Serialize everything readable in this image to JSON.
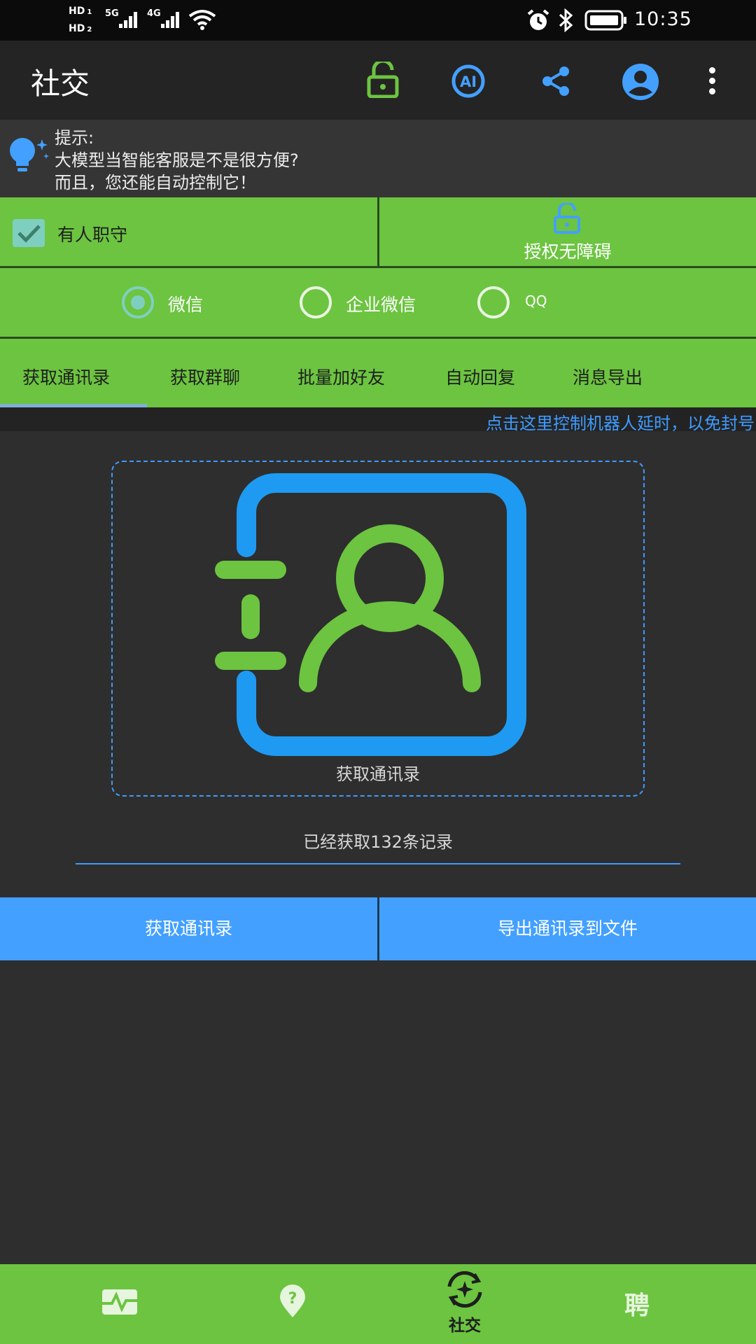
{
  "status_bar": {
    "hd1": "HD",
    "hd1_sub": "1",
    "hd2": "HD",
    "hd2_sub": "2",
    "net1": "5G",
    "net2": "4G",
    "time": "10:35",
    "icons": [
      "alarm-icon",
      "bluetooth-icon",
      "battery-icon",
      "wifi-icon",
      "signal-icon"
    ]
  },
  "app_bar": {
    "title": "社交",
    "actions": [
      "unlock-icon",
      "ai-icon",
      "share-icon",
      "account-icon",
      "more-icon"
    ],
    "ai_label": "AI"
  },
  "tip": {
    "heading": "提示:",
    "line1": "大模型当智能客服是不是很方便?",
    "line2": "而且，您还能自动控制它！"
  },
  "options": {
    "attended_label": "有人职守",
    "attended_checked": true,
    "accessibility_label": "授权无障碍"
  },
  "platforms": {
    "items": [
      "微信",
      "企业微信",
      "QQ"
    ],
    "selected": "微信"
  },
  "tabs": {
    "items": [
      "获取通讯录",
      "获取群聊",
      "批量加好友",
      "自动回复",
      "消息导出"
    ],
    "active": "获取通讯录"
  },
  "delay_link": "点击这里控制机器人延时，以免封号",
  "main": {
    "card_caption": "获取通讯录",
    "record_status": "已经获取132条记录",
    "btn_fetch": "获取通讯录",
    "btn_export": "导出通讯录到文件"
  },
  "bottom_nav": {
    "items": [
      {
        "icon": "pulse-icon",
        "label": ""
      },
      {
        "icon": "help-location-icon",
        "label": ""
      },
      {
        "icon": "social-icon",
        "label": "社交"
      },
      {
        "icon": "recruit-icon",
        "label": "聘"
      }
    ],
    "active": "社交"
  },
  "colors": {
    "green": "#6cc440",
    "blue": "#43a0ff",
    "dark": "#2e2e2e"
  }
}
